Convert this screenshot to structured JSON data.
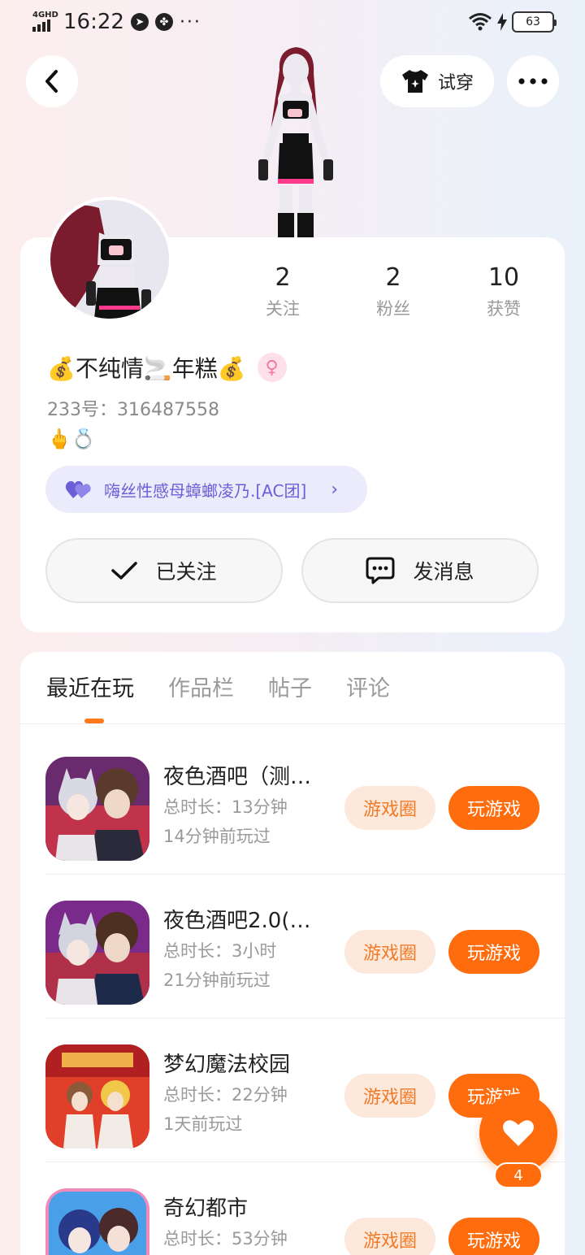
{
  "status_bar": {
    "network": "4GHD",
    "time": "16:22",
    "battery": "63"
  },
  "header": {
    "try_on_label": "试穿"
  },
  "profile": {
    "stats": [
      {
        "value": "2",
        "label": "关注"
      },
      {
        "value": "2",
        "label": "粉丝"
      },
      {
        "value": "10",
        "label": "获赞"
      }
    ],
    "name": "💰不纯情🚬年糕💰",
    "gender_symbol": "♀",
    "uid": "233号：316487558",
    "emoji_sign": "🖕💍",
    "group_name": "嗨丝性感母蟑螂凌乃.[AC团]",
    "follow_label": "已关注",
    "message_label": "发消息"
  },
  "tabs": [
    {
      "label": "最近在玩",
      "active": true
    },
    {
      "label": "作品栏",
      "active": false
    },
    {
      "label": "帖子",
      "active": false
    },
    {
      "label": "评论",
      "active": false
    }
  ],
  "games": [
    {
      "title": "夜色酒吧（测…",
      "duration": "总时长：13分钟",
      "played": "14分钟前玩过",
      "circle": "游戏圈",
      "play": "玩游戏"
    },
    {
      "title": "夜色酒吧2.0(…",
      "duration": "总时长：3小时",
      "played": "21分钟前玩过",
      "circle": "游戏圈",
      "play": "玩游戏"
    },
    {
      "title": "梦幻魔法校园",
      "duration": "总时长：22分钟",
      "played": "1天前玩过",
      "circle": "游戏圈",
      "play": "玩游戏"
    },
    {
      "title": "奇幻都市",
      "duration": "总时长：53分钟",
      "played": "",
      "circle": "游戏圈",
      "play": "玩游戏"
    }
  ],
  "like_fab": {
    "count": "4"
  },
  "colors": {
    "accent": "#ff6c0d",
    "accent_soft": "#fde9dc",
    "group_pill": "#ecebfb",
    "group_text": "#6b5fd8"
  }
}
